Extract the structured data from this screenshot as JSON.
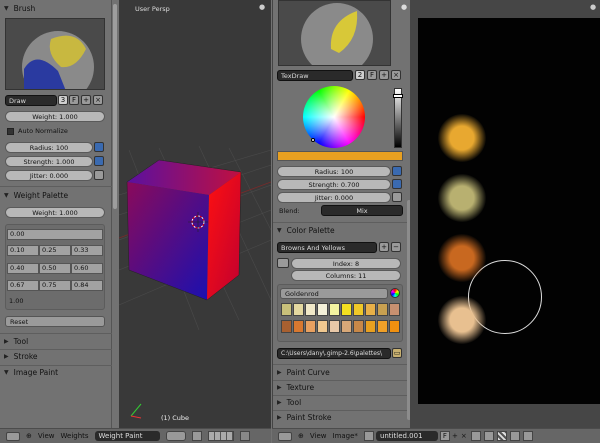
{
  "left": {
    "brush_header": "Brush",
    "brush_name": "Draw",
    "brush_users": "3",
    "f_label": "F",
    "weight": "Weight: 1.000",
    "auto_normalize": "Auto Normalize",
    "radius": "Radius: 100",
    "strength": "Strength: 1.000",
    "jitter": "Jitter: 0.000",
    "weight_palette_header": "Weight Palette",
    "palette_weight": "Weight: 1.000",
    "palette_values": [
      "0.00",
      "0.10",
      "0.25",
      "0.33",
      "0.40",
      "0.50",
      "0.60",
      "0.67",
      "0.75",
      "0.84",
      "1.00"
    ],
    "reset": "Reset",
    "tool": "Tool",
    "stroke": "Stroke",
    "image_paint": "Image Paint"
  },
  "viewport": {
    "label": "User Persp",
    "object": "(1) Cube"
  },
  "mid": {
    "brush_name": "TexDraw",
    "brush_users": "2",
    "f_label": "F",
    "color_hex": "#e8a020",
    "radius": "Radius: 100",
    "strength": "Strength: 0.700",
    "jitter": "Jitter: 0.000",
    "blend_label": "Blend:",
    "blend_value": "Mix",
    "color_palette_header": "Color Palette",
    "palette_name": "Browns And Yellows",
    "index": "Index: 8",
    "columns": "Columns: 11",
    "color_name": "Goldenrod",
    "swatches_row1": [
      "#c8c07a",
      "#e4d8a0",
      "#f0e8c8",
      "#f4f0d8",
      "#f4f4a0",
      "#f4e020",
      "#f0c828",
      "#e8b048",
      "#c8a050",
      "#c89070"
    ],
    "swatches_row2": [
      "#a86030",
      "#d87830",
      "#e8a060",
      "#f0c890",
      "#e8c8a8",
      "#d8a878",
      "#c88848",
      "#e8a020",
      "#f0a028",
      "#f09010"
    ],
    "path": "C:\\Users\\dany\\.gimp-2.6\\palettes\\",
    "paint_curve": "Paint Curve",
    "texture": "Texture",
    "tool": "Tool",
    "paint_stroke": "Paint Stroke"
  },
  "right_dots": [
    "#e8a830",
    "#b8b070",
    "#c86820",
    "#e8c090"
  ],
  "bottom_left": {
    "view": "View",
    "weights": "Weights",
    "mode": "Weight Paint"
  },
  "bottom_right": {
    "view": "View",
    "image": "Image*",
    "image_name": "untitled.001",
    "f_label": "F"
  }
}
